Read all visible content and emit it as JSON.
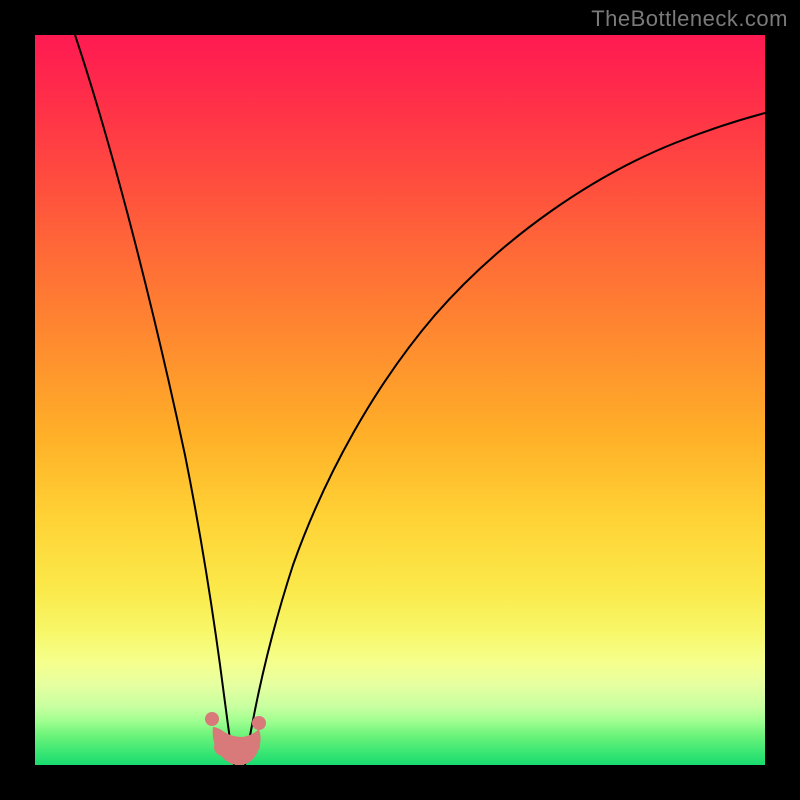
{
  "watermark": "TheBottleneck.com",
  "chart_data": {
    "type": "line",
    "title": "",
    "xlabel": "",
    "ylabel": "",
    "xlim": [
      0,
      100
    ],
    "ylim": [
      0,
      100
    ],
    "grid": false,
    "legend": false,
    "notes": "Asymmetric V-shaped curve on rainbow gradient background (red at top through orange/yellow to green at bottom). No axes, ticks, or labels are visible. x and y values are estimated as percentages of the plot area (x left→right, y bottom→top).",
    "series": [
      {
        "name": "curve",
        "x": [
          5.5,
          8,
          11,
          14,
          17,
          20,
          23,
          25,
          26.7,
          28,
          30,
          33,
          37,
          42,
          48,
          55,
          63,
          72,
          82,
          92,
          100
        ],
        "y": [
          100,
          82,
          66,
          52,
          40,
          28,
          17,
          8,
          0,
          4,
          12,
          22,
          33,
          44,
          54,
          62,
          70,
          76,
          81,
          85,
          88
        ]
      }
    ],
    "markers": {
      "note": "Coral/pink marker cluster at the curve's minimum",
      "x_range": [
        23.5,
        30.3
      ],
      "y_range": [
        0,
        7
      ],
      "points": [
        {
          "x": 23.7,
          "y": 6.5
        },
        {
          "x": 30.1,
          "y": 6.0
        }
      ]
    },
    "background_gradient": {
      "top": "#ff1a52",
      "middle": "#ffd235",
      "bottom": "#18db6f"
    }
  }
}
